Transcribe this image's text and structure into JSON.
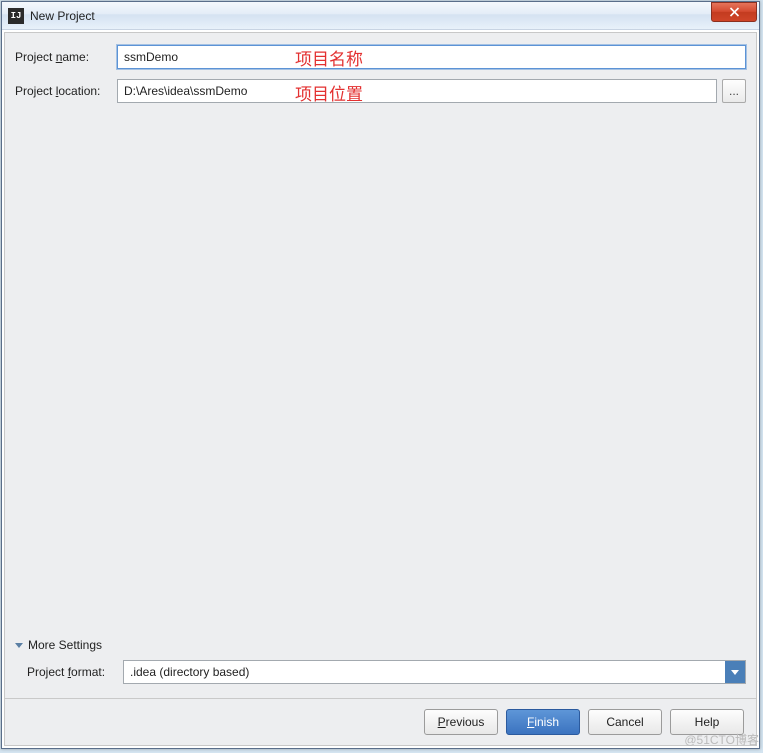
{
  "window": {
    "title": "New Project"
  },
  "form": {
    "name_label": "Project name:",
    "name_underline": "n",
    "name_value": "ssmDemo",
    "location_label": "Project location:",
    "location_underline": "l",
    "location_value": "D:\\Ares\\idea\\ssmDemo",
    "browse_label": "..."
  },
  "annotations": {
    "name": "项目名称",
    "location": "项目位置"
  },
  "more_settings": {
    "label": "More Settings",
    "format_label": "Project format:",
    "format_underline": "f",
    "format_value": ".idea (directory based)"
  },
  "buttons": {
    "previous": "Previous",
    "previous_underline": "P",
    "finish": "Finish",
    "finish_underline": "F",
    "cancel": "Cancel",
    "help": "Help"
  },
  "watermark": "@51CTO博客"
}
